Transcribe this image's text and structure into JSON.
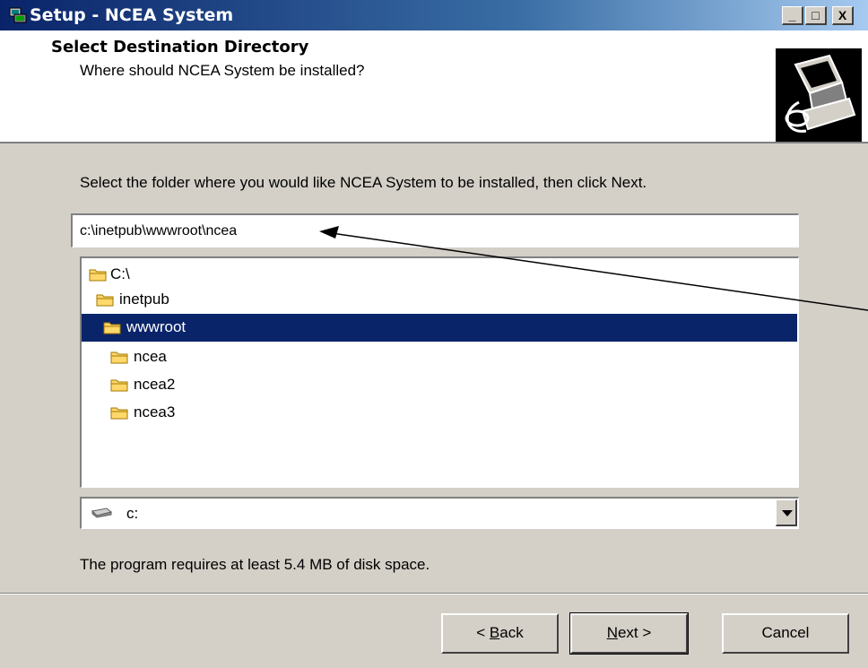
{
  "window": {
    "title": "Setup - NCEA System",
    "controls": {
      "minimize": "_",
      "maximize": "□",
      "close": "X"
    }
  },
  "header": {
    "title": "Select Destination Directory",
    "subtitle": "Where should NCEA System be installed?"
  },
  "main": {
    "intro": "Select the folder where you would like NCEA System to be installed, then click Next.",
    "path_value": "c:\\inetpub\\wwwroot\\ncea",
    "tree": [
      {
        "label": "C:\\",
        "selected": false
      },
      {
        "label": "inetpub",
        "selected": false
      },
      {
        "label": "wwwroot",
        "selected": true
      },
      {
        "label": "ncea",
        "selected": false
      },
      {
        "label": "ncea2",
        "selected": false
      },
      {
        "label": "ncea3",
        "selected": false
      }
    ],
    "drive": "c:",
    "disk_space": "The program requires at least 5.4 MB of disk space."
  },
  "buttons": {
    "back_prefix": "< ",
    "back_key": "B",
    "back_rest": "ack",
    "next_key": "N",
    "next_rest": "ext >",
    "cancel": "Cancel"
  },
  "colors": {
    "selection": "#0a246a",
    "dialog": "#d4d0c8",
    "title_gradient_start": "#0a246a"
  },
  "icons": [
    "setup-icon",
    "folder-icon",
    "drive-icon",
    "dropdown-arrow-icon",
    "install-computer-icon"
  ]
}
